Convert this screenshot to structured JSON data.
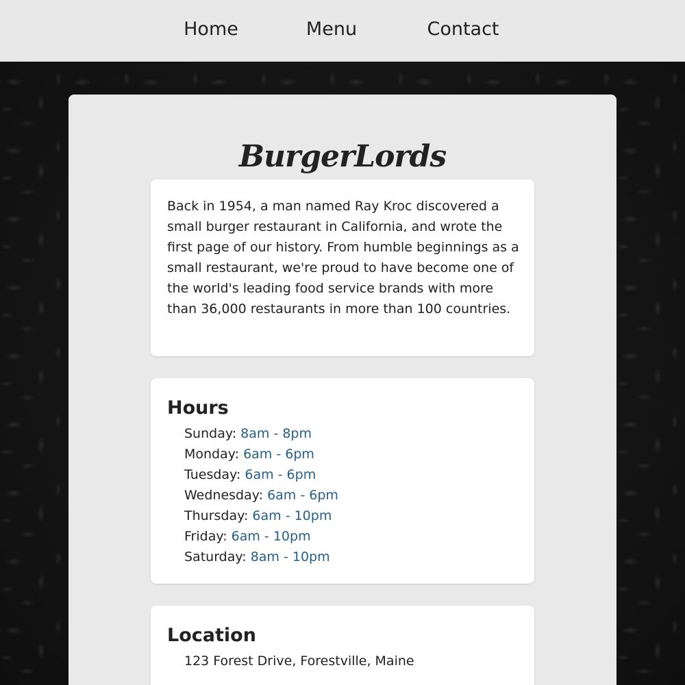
{
  "nav": {
    "home": "Home",
    "menu": "Menu",
    "contact": "Contact"
  },
  "site": {
    "title": "BurgerLords"
  },
  "about": {
    "text": "Back in 1954, a man named Ray Kroc discovered a small burger restaurant in California, and wrote the first page of our history. From humble beginnings as a small restaurant, we're proud to have become one of the world's leading food service brands with more than 36,000 restaurants in more than 100 countries."
  },
  "hours": {
    "heading": "Hours",
    "days": [
      {
        "day": "Sunday:",
        "time": "8am - 8pm"
      },
      {
        "day": "Monday:",
        "time": "6am - 6pm"
      },
      {
        "day": "Tuesday:",
        "time": "6am - 6pm"
      },
      {
        "day": "Wednesday:",
        "time": "6am - 6pm"
      },
      {
        "day": "Thursday:",
        "time": "6am - 10pm"
      },
      {
        "day": "Friday:",
        "time": "6am - 10pm"
      },
      {
        "day": "Saturday:",
        "time": "8am - 10pm"
      }
    ]
  },
  "location": {
    "heading": "Location",
    "address": "123 Forest Drive, Forestville, Maine"
  },
  "colors": {
    "nav_bg": "#e8e8e8",
    "panel_bg": "#e9e9e9",
    "card_bg": "#ffffff",
    "time_accent": "#1f5f96",
    "page_bg": "#141414"
  }
}
